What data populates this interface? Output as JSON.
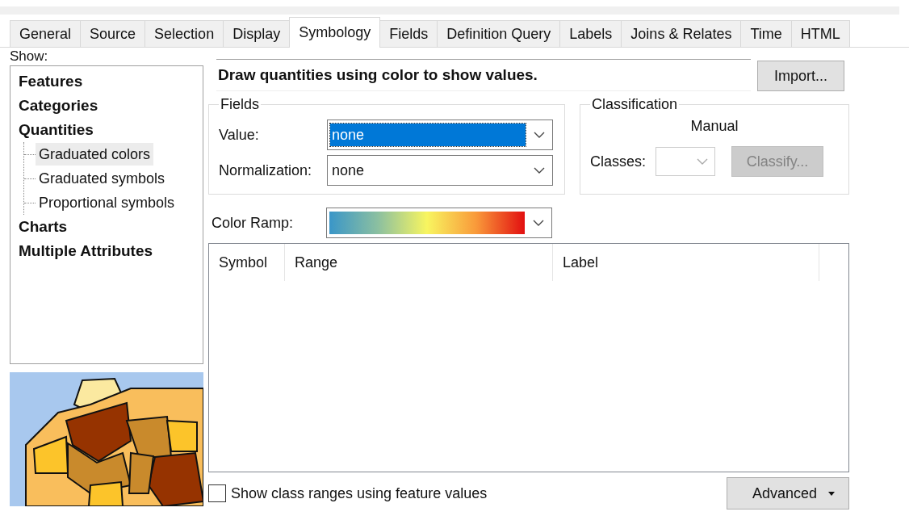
{
  "tabs": [
    {
      "label": "General",
      "selected": false
    },
    {
      "label": "Source",
      "selected": false
    },
    {
      "label": "Selection",
      "selected": false
    },
    {
      "label": "Display",
      "selected": false
    },
    {
      "label": "Symbology",
      "selected": true
    },
    {
      "label": "Fields",
      "selected": false
    },
    {
      "label": "Definition Query",
      "selected": false
    },
    {
      "label": "Labels",
      "selected": false
    },
    {
      "label": "Joins & Relates",
      "selected": false
    },
    {
      "label": "Time",
      "selected": false
    },
    {
      "label": "HTML",
      "selected": false
    }
  ],
  "show": {
    "label": "Show:",
    "items": [
      {
        "label": "Features",
        "selected": false
      },
      {
        "label": "Categories",
        "selected": false
      },
      {
        "label": "Quantities",
        "selected": false,
        "children": [
          {
            "label": "Graduated colors",
            "selected": true
          },
          {
            "label": "Graduated symbols",
            "selected": false
          },
          {
            "label": "Proportional symbols",
            "selected": false
          }
        ]
      },
      {
        "label": "Charts",
        "selected": false
      },
      {
        "label": "Multiple Attributes",
        "selected": false
      }
    ]
  },
  "description": "Draw quantities using color to show values.",
  "import_button": "Import...",
  "fields": {
    "title": "Fields",
    "value": {
      "label": "Value:",
      "value": "none",
      "focused": true
    },
    "normalization": {
      "label": "Normalization:",
      "value": "none",
      "focused": false
    }
  },
  "classification": {
    "title": "Classification",
    "method": "Manual",
    "classes_label": "Classes:",
    "classify_button": "Classify...",
    "disabled": true
  },
  "color_ramp": {
    "label": "Color Ramp:"
  },
  "table": {
    "columns": [
      "Symbol",
      "Range",
      "Label"
    ]
  },
  "show_ranges": {
    "label": "Show class ranges using feature values",
    "checked": false
  },
  "advanced_button": "Advanced"
}
